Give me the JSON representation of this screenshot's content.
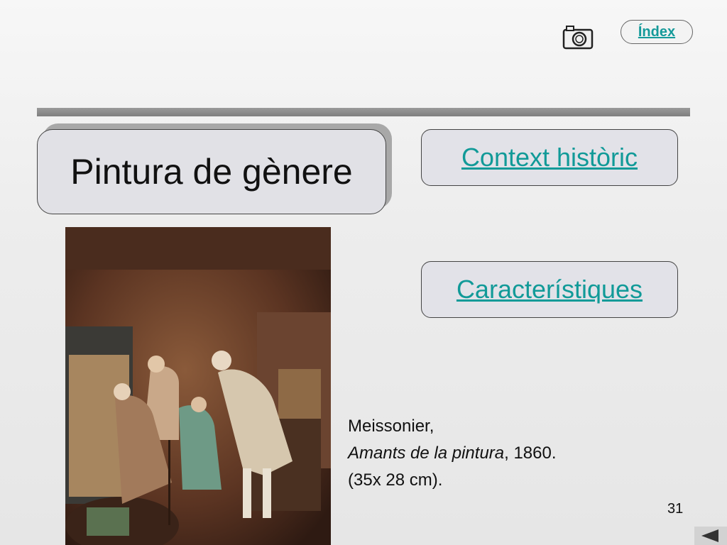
{
  "header": {
    "index_label": "Índex",
    "camera_icon": "camera-icon"
  },
  "title": "Pintura de gènere",
  "buttons": {
    "context": "Context històric",
    "caracteristiques": "Característiques"
  },
  "caption": {
    "artist": "Meissonier,",
    "work": "Amants de la pintura",
    "year": ", 1860.",
    "size": "(35x 28 cm)."
  },
  "page_number": "31",
  "colors": {
    "link": "#119a98",
    "accent_bar": "#8a8a8a"
  }
}
